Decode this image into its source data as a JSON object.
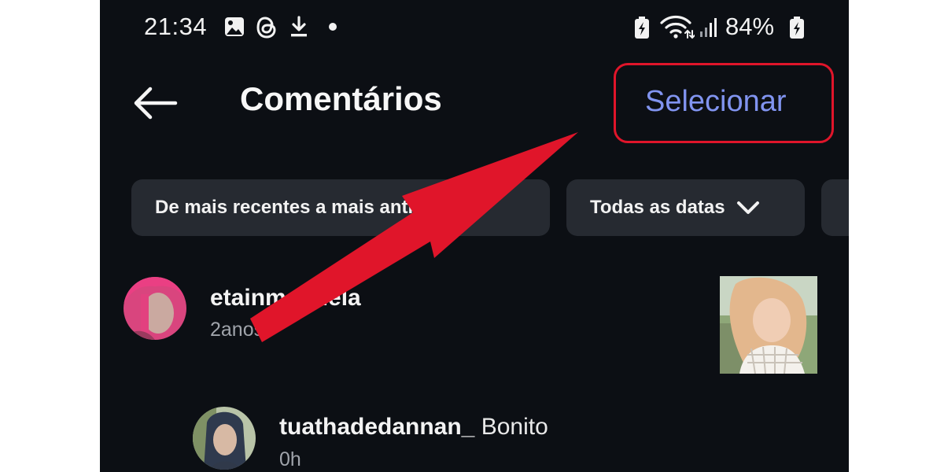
{
  "status_bar": {
    "time": "21:34",
    "battery_percent": "84%",
    "left_icons": [
      "gallery-icon",
      "threads-icon",
      "download-icon",
      "dot-icon"
    ],
    "right_icons": [
      "battery-saver-icon",
      "wifi-icon",
      "signal-icon",
      "battery-charging-icon"
    ]
  },
  "header": {
    "back_icon": "arrow-left-icon",
    "title": "Comentários",
    "select_label": "Selecionar"
  },
  "filters": [
    {
      "label": "De mais recentes a mais antigos",
      "icon": "chevron-down-icon"
    },
    {
      "label": "Todas as datas",
      "icon": "chevron-down-icon"
    }
  ],
  "comments": [
    {
      "username": "etainmanuela",
      "text": "",
      "meta": "2anos"
    },
    {
      "username": "tuathadedannan_",
      "text": "Bonito",
      "meta": "0h"
    }
  ],
  "annotation": {
    "arrow_color": "#e0152a",
    "box_color": "#e0152a"
  },
  "colors": {
    "background": "#0c0f14",
    "chip": "#262a31",
    "accent": "#8194f0"
  }
}
